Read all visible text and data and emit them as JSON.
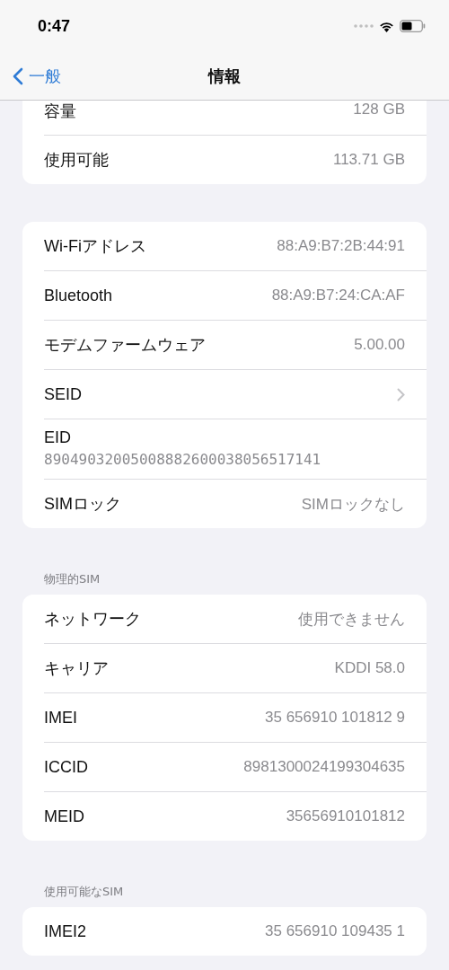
{
  "status_bar": {
    "time": "0:47"
  },
  "nav": {
    "back": "一般",
    "title": "情報"
  },
  "sections": [
    {
      "cut_top": true,
      "rows": [
        {
          "kind": "value",
          "label": "容量",
          "value": "128 GB"
        },
        {
          "kind": "value",
          "label": "使用可能",
          "value": "113.71 GB"
        }
      ]
    },
    {
      "cut_top": false,
      "rows": [
        {
          "kind": "value",
          "label": "Wi-Fiアドレス",
          "value": "88:A9:B7:2B:44:91"
        },
        {
          "kind": "value",
          "label": "Bluetooth",
          "value": "88:A9:B7:24:CA:AF"
        },
        {
          "kind": "value",
          "label": "モデムファームウェア",
          "value": "5.00.00"
        },
        {
          "kind": "chevron",
          "label": "SEID"
        },
        {
          "kind": "stacked",
          "label": "EID",
          "value": "89049032005008882600038056517141"
        },
        {
          "kind": "value",
          "label": "SIMロック",
          "value": "SIMロックなし"
        }
      ]
    },
    {
      "header": "物理的SIM",
      "cut_top": false,
      "rows": [
        {
          "kind": "value",
          "label": "ネットワーク",
          "value": "使用できません"
        },
        {
          "kind": "value",
          "label": "キャリア",
          "value": "KDDI 58.0"
        },
        {
          "kind": "value",
          "label": "IMEI",
          "value": "35 656910 101812 9"
        },
        {
          "kind": "value",
          "label": "ICCID",
          "value": "8981300024199304635"
        },
        {
          "kind": "value",
          "label": "MEID",
          "value": "35656910101812"
        }
      ]
    },
    {
      "header": "使用可能なSIM",
      "cut_top": false,
      "rows": [
        {
          "kind": "value",
          "label": "IMEI2",
          "value": "35 656910 109435 1"
        }
      ]
    }
  ]
}
